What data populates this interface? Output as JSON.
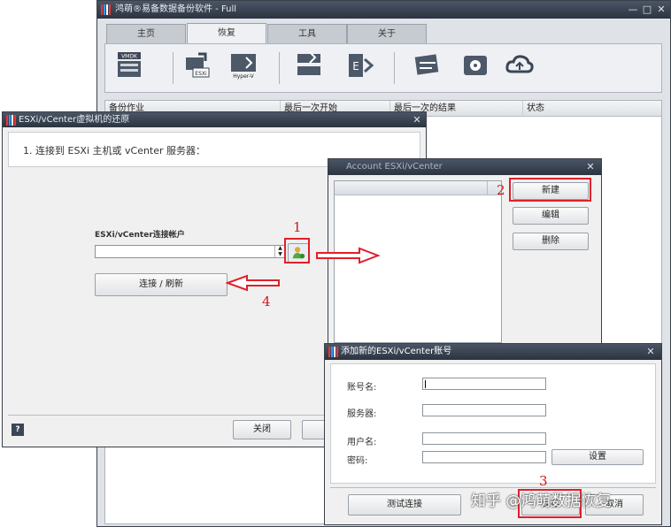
{
  "main_window": {
    "title": "鸿萌®易备数据备份软件 - Full",
    "tabs": [
      "主页",
      "恢复",
      "工具",
      "关于"
    ],
    "active_tab": "恢复",
    "toolbar_icons": [
      "vmdk-restore-icon",
      "esxi-restore-icon",
      "hyperv-restore-icon",
      "server-restore-icon",
      "exchange-restore-icon",
      "ftp-restore-icon",
      "disk-restore-icon",
      "cloud-restore-icon"
    ],
    "toolbar_icon_labels": {
      "vmdk": "VMDK",
      "esxi": "ESXi",
      "hyperv": "Hyper-V"
    },
    "columns": [
      "备份作业",
      "最后一次开始",
      "最后一次的结果",
      "状态"
    ]
  },
  "esxi_dialog": {
    "title": "ESXi/vCenter虚拟机的还原",
    "step": "1. 连接到 ESXi 主机或 vCenter 服务器：",
    "account_label": "ESXi/vCenter连接帐户",
    "account_value": "",
    "connect_button": "连接 / 刷新",
    "close_button": "关闭",
    "help_icon_text": "?"
  },
  "account_dialog": {
    "title": "Account ESXi/vCenter",
    "new_button": "新建",
    "edit_button": "编辑",
    "delete_button": "删除"
  },
  "add_dialog": {
    "title": "添加新的ESXi/vCenter账号",
    "account_name_label": "账号名:",
    "server_label": "服务器:",
    "username_label": "用户名:",
    "password_label": "密码:",
    "settings_button": "设置",
    "test_button": "测试连接",
    "save_button": "保存",
    "cancel_button": "取消"
  },
  "annotations": {
    "n1": "1",
    "n2": "2",
    "n3": "3",
    "n4": "4"
  },
  "watermark": "知乎 @鸿萌数据恢复",
  "colors": {
    "accent_red": "#e0202a",
    "titlebar": "#2c3440"
  }
}
